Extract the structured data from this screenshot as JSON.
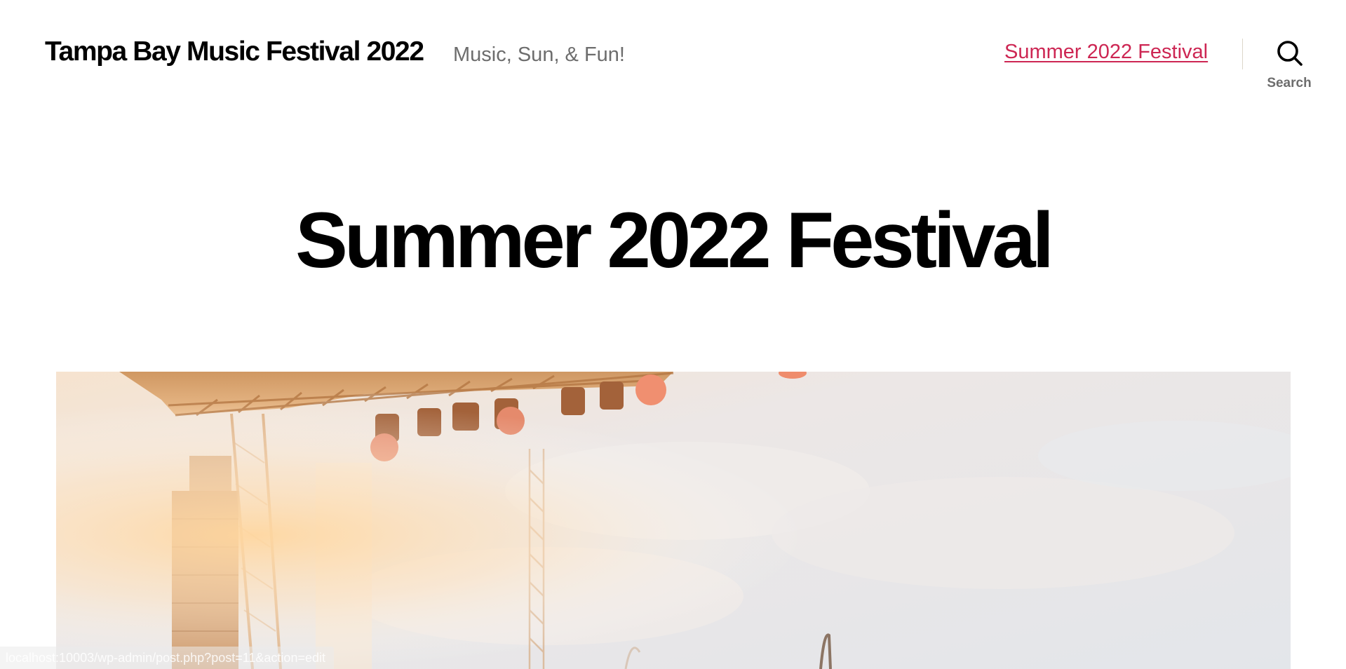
{
  "header": {
    "site_title": "Tampa Bay Music Festival 2022",
    "site_description": "Music, Sun, & Fun!",
    "menu": [
      {
        "label": "Summer 2022 Festival"
      }
    ],
    "search": {
      "label": "Search",
      "icon": "search-icon"
    }
  },
  "entry": {
    "title": "Summer 2022 Festival"
  },
  "featured_image": {
    "subject": "festival-stage-photo"
  },
  "status_bar": {
    "url": "localhost:10003/wp-admin/post.php?post=11&action=edit"
  },
  "colors": {
    "accent": "#cd2653",
    "text": "#000000",
    "secondary": "#6d6d6d",
    "divider": "#dcd7ca",
    "background": "#ffffff"
  }
}
